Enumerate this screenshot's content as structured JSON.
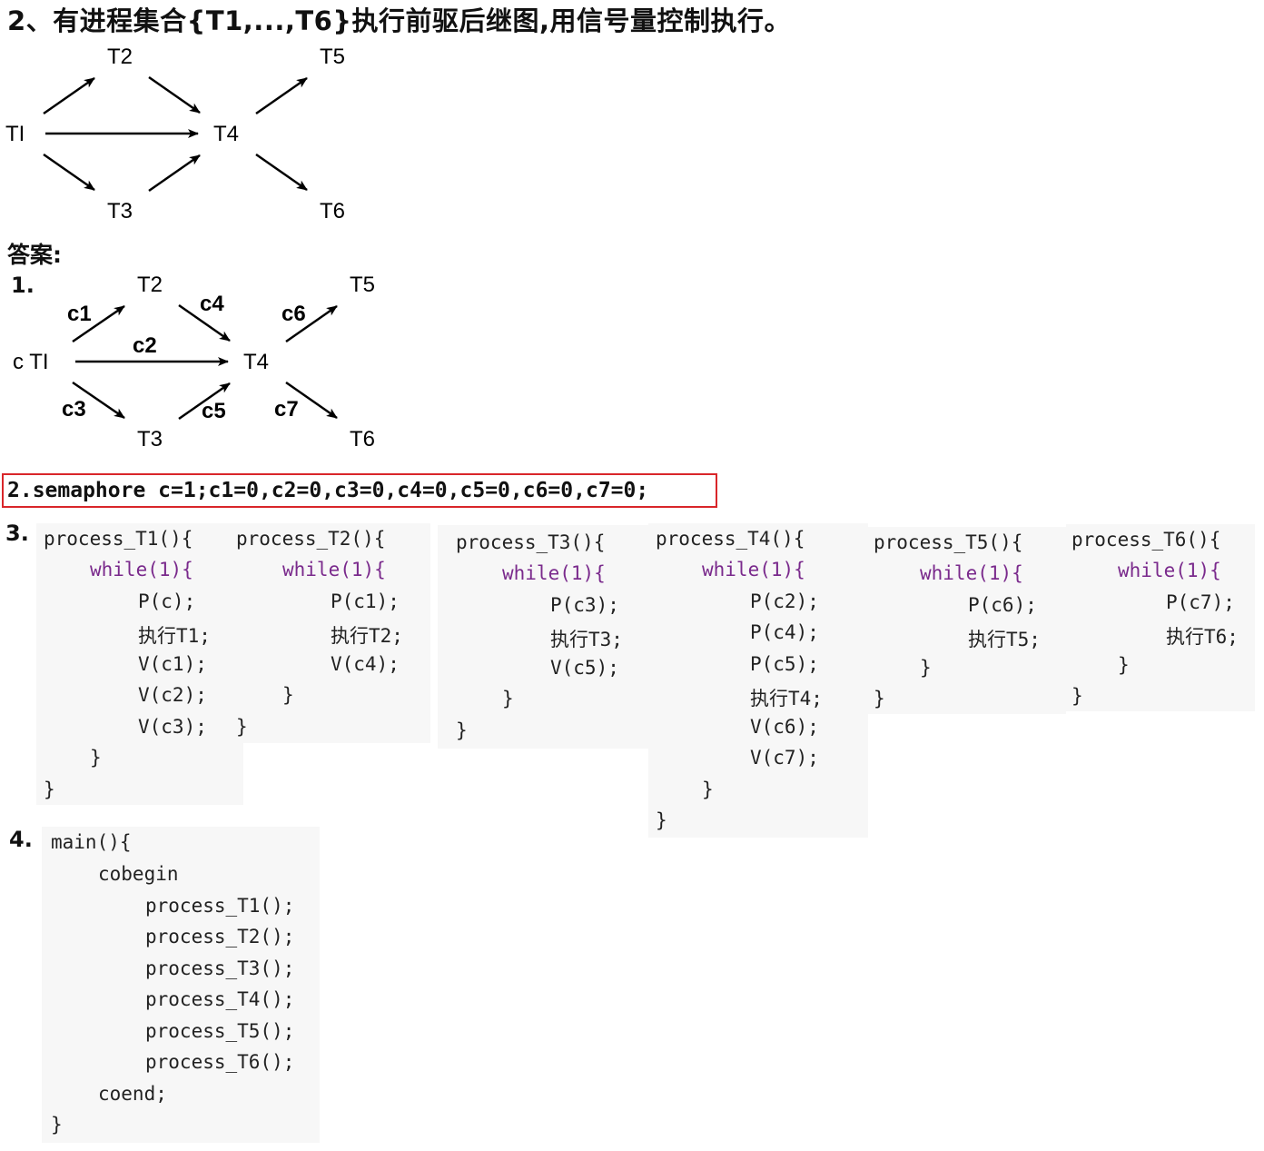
{
  "question": {
    "title": "2、有进程集合{T1,...,T6}执行前驱后继图,用信号量控制执行。"
  },
  "graph1": {
    "nodes": {
      "t1": "TI",
      "t2": "T2",
      "t3": "T3",
      "t4": "T4",
      "t5": "T5",
      "t6": "T6"
    }
  },
  "answer": {
    "heading": "答案:",
    "step1_num": "1.",
    "step2_text": "2.semaphore c=1;c1=0,c2=0,c3=0,c4=0,c5=0,c6=0,c7=0;",
    "step3_num": "3.",
    "step4_num": "4."
  },
  "graph2": {
    "nodes": {
      "t1": "c TI",
      "t2": "T2",
      "t3": "T3",
      "t4": "T4",
      "t5": "T5",
      "t6": "T6"
    },
    "edge_labels": {
      "c1": "c1",
      "c2": "c2",
      "c3": "c3",
      "c4": "c4",
      "c5": "c5",
      "c6": "c6",
      "c7": "c7"
    }
  },
  "code": {
    "t1": [
      "process_T1(){",
      "while(1){",
      "P(c);",
      "执行T1;",
      "V(c1);",
      "V(c2);",
      "V(c3);",
      "}",
      "}"
    ],
    "t2": [
      "process_T2(){",
      "while(1){",
      "P(c1);",
      "执行T2;",
      "V(c4);",
      "}",
      "}"
    ],
    "t3": [
      "process_T3(){",
      "while(1){",
      "P(c3);",
      "执行T3;",
      "V(c5);",
      "}",
      "}"
    ],
    "t4": [
      "process_T4(){",
      "while(1){",
      "P(c2);",
      "P(c4);",
      "P(c5);",
      "执行T4;",
      "V(c6);",
      "V(c7);",
      "}",
      "}"
    ],
    "t5": [
      "process_T5(){",
      "while(1){",
      "P(c6);",
      "执行T5;",
      "}",
      "}"
    ],
    "t6": [
      "process_T6(){",
      "while(1){",
      "P(c7);",
      "执行T6;",
      "}",
      "}"
    ],
    "main": [
      "main(){",
      "cobegin",
      "process_T1();",
      "process_T2();",
      "process_T3();",
      "process_T4();",
      "process_T5();",
      "process_T6();",
      "coend;",
      "}"
    ]
  }
}
